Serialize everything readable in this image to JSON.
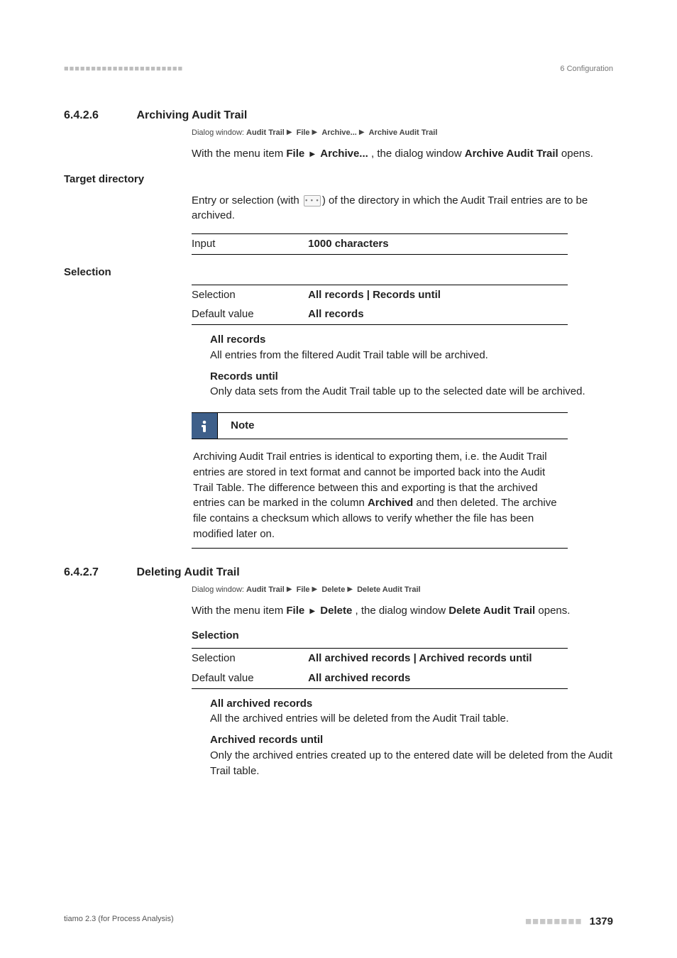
{
  "header": {
    "squares": "■■■■■■■■■■■■■■■■■■■■■■",
    "chapter": "6 Configuration"
  },
  "s626": {
    "num": "6.4.2.6",
    "title": "Archiving Audit Trail",
    "dialog": {
      "prefix": "Dialog window: ",
      "parts": [
        "Audit Trail",
        "File",
        "Archive...",
        "Archive Audit Trail"
      ]
    },
    "intro_pre": "With the menu item ",
    "intro_b1": "File",
    "intro_mid": " ",
    "intro_b2": "Archive...",
    "intro_post": ", the dialog window ",
    "intro_b3": "Archive Audit Trail",
    "intro_tail": " opens.",
    "target_dir": {
      "heading": "Target directory",
      "line_pre": "Entry or selection (with ",
      "icon_name": "browse-icon",
      "line_post": ") of the directory in which the Audit Trail entries are to be archived.",
      "table": {
        "k": "Input",
        "v": "1000 characters"
      }
    },
    "selection": {
      "heading": "Selection",
      "rows": [
        {
          "k": "Selection",
          "v": "All records | Records until"
        },
        {
          "k": "Default value",
          "v": "All records"
        }
      ],
      "opt1_h": "All records",
      "opt1_t": "All entries from the filtered Audit Trail table will be archived.",
      "opt2_h": "Records until",
      "opt2_t": "Only data sets from the Audit Trail table up to the selected date will be archived."
    },
    "note": {
      "label": "Note",
      "body_pre": "Archiving Audit Trail entries is identical to exporting them, i.e. the Audit Trail entries are stored in text format and cannot be imported back into the Audit Trail Table. The difference between this and exporting is that the archived entries can be marked in the column ",
      "body_b": "Archived",
      "body_post": " and then deleted. The archive file contains a checksum which allows to verify whether the file has been modified later on."
    }
  },
  "s627": {
    "num": "6.4.2.7",
    "title": "Deleting Audit Trail",
    "dialog": {
      "prefix": "Dialog window: ",
      "parts": [
        "Audit Trail",
        "File",
        "Delete",
        "Delete Audit Trail"
      ]
    },
    "intro_pre": "With the menu item ",
    "intro_b1": "File",
    "intro_mid": " ",
    "intro_b2": "Delete",
    "intro_post": ", the dialog window ",
    "intro_b3": "Delete Audit Trail",
    "intro_tail": " opens.",
    "sel_head": "Selection",
    "rows": [
      {
        "k": "Selection",
        "v": "All archived records | Archived records until"
      },
      {
        "k": "Default value",
        "v": "All archived records"
      }
    ],
    "opt1_h": "All archived records",
    "opt1_t": "All the archived entries will be deleted from the Audit Trail table.",
    "opt2_h": "Archived records until",
    "opt2_t": "Only the archived entries created up to the entered date will be deleted from the Audit Trail table."
  },
  "footer": {
    "left": "tiamo 2.3 (for Process Analysis)",
    "squares": "■■■■■■■■",
    "page": "1379"
  }
}
